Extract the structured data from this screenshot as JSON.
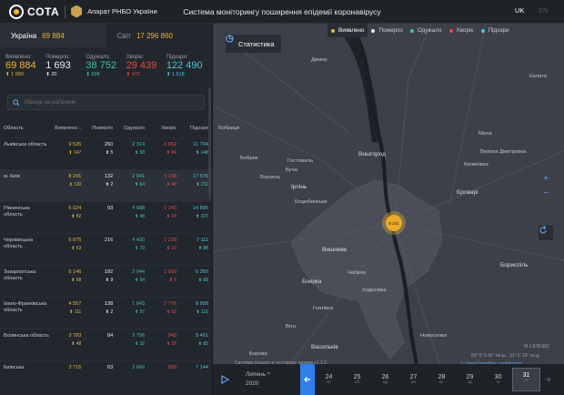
{
  "header": {
    "logo_text": "COTA",
    "agency": "Апарат РНБО України",
    "title": "Система моніторингу поширення епідемії коронавірусу",
    "lang_uk": "UK",
    "lang_en": "EN"
  },
  "scope": {
    "ukraine_label": "Україна",
    "ukraine_count": "69 884",
    "world_label": "Світ",
    "world_count": "17 296 860"
  },
  "totals": {
    "confirmed": {
      "label": "Виявлено:",
      "value": "69 884",
      "delta": "1 090"
    },
    "deaths": {
      "label": "Померло:",
      "value": "1 693",
      "delta": "20"
    },
    "recovered": {
      "label": "Одужало:",
      "value": "38 752",
      "delta": "598"
    },
    "sick": {
      "label": "Хворіє:",
      "value": "29 439",
      "delta": "472"
    },
    "suspected": {
      "label": "Підозри:",
      "value": "122 490",
      "delta": "1 518"
    }
  },
  "search": {
    "placeholder": "Пошук за регіоном"
  },
  "table": {
    "headers": {
      "region": "Область",
      "confirmed": "Виявлено",
      "deaths": "Померло",
      "recovered": "Одужало",
      "sick": "Хворіє",
      "suspected": "Підозри"
    },
    "rows": [
      {
        "name": "Львівська область",
        "confirmed": "9 526",
        "confirmed_d": "147",
        "deaths": "260",
        "deaths_d": "5",
        "recovered": "2 314",
        "recovered_d": "58",
        "sick": "6 952",
        "sick_d": "84",
        "suspected": "11 704",
        "suspected_d": "148"
      },
      {
        "name": "м. Київ",
        "confirmed": "8 241",
        "confirmed_d": "110",
        "deaths": "132",
        "deaths_d": "2",
        "recovered": "2 941",
        "recovered_d": "64",
        "sick": "5 168",
        "sick_d": "48",
        "suspected": "17 576",
        "suspected_d": "211"
      },
      {
        "name": "Рівненська область",
        "confirmed": "6 024",
        "confirmed_d": "82",
        "deaths": "93",
        "deaths_d": "",
        "recovered": "4 688",
        "recovered_d": "48",
        "sick": "1 243",
        "sick_d": "34",
        "suspected": "14 895",
        "suspected_d": "107"
      },
      {
        "name": "Чернівецька область",
        "confirmed": "5 875",
        "confirmed_d": "63",
        "deaths": "216",
        "deaths_d": "",
        "recovered": "4 430",
        "recovered_d": "73",
        "sick": "1 229",
        "sick_d": "10",
        "suspected": "7 111",
        "suspected_d": "88"
      },
      {
        "name": "Закарпатська область",
        "confirmed": "5 146",
        "confirmed_d": "68",
        "deaths": "192",
        "deaths_d": "9",
        "recovered": "2 044",
        "recovered_d": "64",
        "sick": "2 910",
        "sick_d": "5",
        "suspected": "6 350",
        "suspected_d": "68"
      },
      {
        "name": "Івано-Франківська область",
        "confirmed": "4 557",
        "confirmed_d": "111",
        "deaths": "138",
        "deaths_d": "2",
        "recovered": "1 643",
        "recovered_d": "57",
        "sick": "2 776",
        "sick_d": "52",
        "suspected": "8 899",
        "suspected_d": "110"
      },
      {
        "name": "Волинська область",
        "confirmed": "3 783",
        "confirmed_d": "48",
        "deaths": "84",
        "deaths_d": "",
        "recovered": "2 756",
        "recovered_d": "32",
        "sick": "943",
        "sick_d": "16",
        "suspected": "5 491",
        "suspected_d": "65"
      },
      {
        "name": "Київська",
        "confirmed": "3 716",
        "confirmed_d": "",
        "deaths": "63",
        "deaths_d": "",
        "recovered": "2 660",
        "recovered_d": "",
        "sick": "993",
        "sick_d": "",
        "suspected": "7 144",
        "suspected_d": ""
      }
    ]
  },
  "map": {
    "stat_button": "Статистика",
    "legend": [
      "Виявлено",
      "Померло",
      "Одужало",
      "Хворіє",
      "Підозри"
    ],
    "legend_colors": [
      "#f0b42f",
      "#e9ecef",
      "#36c6a0",
      "#ec4b43",
      "#49c9d6"
    ],
    "cluster_label": "8 241",
    "places": [
      "Димер",
      "Калита",
      "Бобриця",
      "Велика Дмитровка",
      "Мила",
      "Вишгород",
      "Калинівка",
      "Гостомель",
      "Бобрик",
      "Ворзель",
      "Буча",
      "Ірпінь",
      "Броварі",
      "Боярка",
      "Ходосівка",
      "Бориспіль",
      "Чабани",
      "Гнатівка",
      "Віта",
      "Новоселки",
      "Васильків",
      "Борова"
    ],
    "big_places": [
      "Вишгород",
      "Ірпінь",
      "Броварі",
      "Боярка",
      "Бориспіль",
      "Коцюбинське",
      "Вишневе"
    ],
    "note": "Система працює в тестовому режимі v1.1.3",
    "copyright": "© OpenStreetMap contributors",
    "scale": "M 1:678 682",
    "coords": "50° 6' 5.41\" пн.ш., 31° 6' 15\" сх.д."
  },
  "timeline": {
    "month": "Липень",
    "year": "2020",
    "days": [
      {
        "n": "24",
        "w": "пт"
      },
      {
        "n": "25",
        "w": "сб"
      },
      {
        "n": "26",
        "w": "нд"
      },
      {
        "n": "27",
        "w": "пн"
      },
      {
        "n": "28",
        "w": "вт"
      },
      {
        "n": "29",
        "w": "ср"
      },
      {
        "n": "30",
        "w": "чт"
      },
      {
        "n": "31",
        "w": "пт"
      }
    ]
  }
}
